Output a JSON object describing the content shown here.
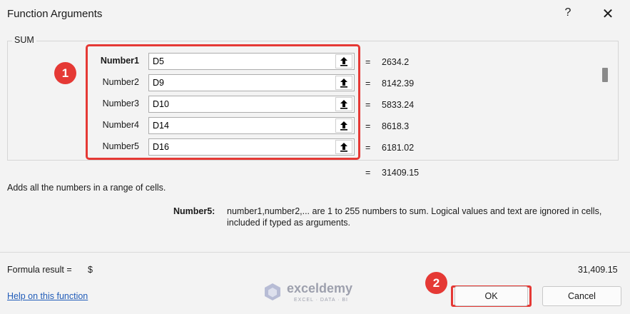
{
  "dialog": {
    "title": "Function Arguments",
    "help_glyph": "?",
    "close_glyph": "✕"
  },
  "function_group": {
    "label": "SUM",
    "arguments": [
      {
        "label": "Number1",
        "value": "D5",
        "result": "2634.2",
        "equals": "="
      },
      {
        "label": "Number2",
        "value": "D9",
        "result": "8142.39",
        "equals": "="
      },
      {
        "label": "Number3",
        "value": "D10",
        "result": "5833.24",
        "equals": "="
      },
      {
        "label": "Number4",
        "value": "D14",
        "result": "8618.3",
        "equals": "="
      },
      {
        "label": "Number5",
        "value": "D16",
        "result": "6181.02",
        "equals": "="
      }
    ]
  },
  "total": {
    "equals": "=",
    "value": "31409.15"
  },
  "description": "Adds all the numbers in a range of cells.",
  "argument_help": {
    "name": "Number5:",
    "text_line1": "number1,number2,... are 1 to 255 numbers to sum. Logical values and text are ignored in cells,",
    "text_line2": "included if typed as arguments."
  },
  "formula_result": {
    "label": "Formula result =",
    "currency": "$",
    "value": "31,409.15"
  },
  "help_link": "Help on this function",
  "buttons": {
    "ok": "OK",
    "cancel": "Cancel"
  },
  "badges": {
    "first": "1",
    "second": "2"
  },
  "watermark": {
    "name": "exceldemy",
    "tagline": "EXCEL · DATA · BI"
  },
  "colors": {
    "annotation": "#e53935",
    "link": "#1f5bb8",
    "dialog_bg": "#f3f3f3"
  },
  "icons": {
    "ref_button": "upload-arrow-icon"
  }
}
